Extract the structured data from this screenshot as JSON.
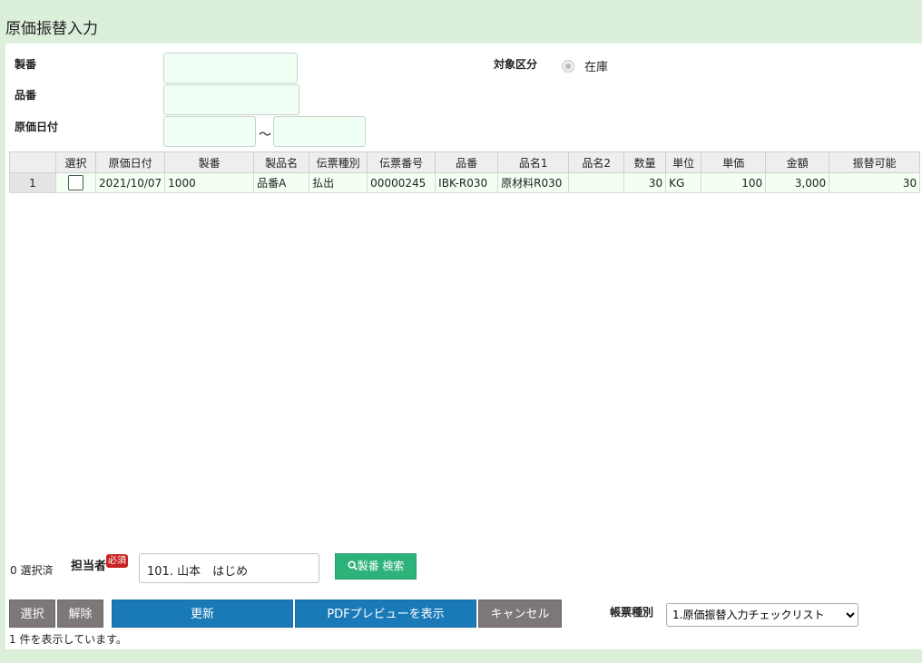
{
  "page": {
    "title": "原価振替入力"
  },
  "form": {
    "seiban_label": "製番",
    "hinban_label": "品番",
    "date_label": "原価日付",
    "range_sep": "～",
    "target_label": "対象区分",
    "target_option": "在庫"
  },
  "table": {
    "headers": [
      "",
      "選択",
      "原価日付",
      "製番",
      "製品名",
      "伝票種別",
      "伝票番号",
      "品番",
      "品名1",
      "品名2",
      "数量",
      "単位",
      "単価",
      "金額",
      "振替可能"
    ],
    "rows": [
      {
        "no": "1",
        "date": "2021/10/07",
        "seiban": "1000",
        "product": "品番A",
        "slip_type": "払出",
        "slip_no": "00000245",
        "hinban": "IBK-R030",
        "name1": "原材料R030",
        "name2": "",
        "qty": "30",
        "unit": "KG",
        "price": "100",
        "amount": "3,000",
        "transferable": "30"
      }
    ]
  },
  "footer": {
    "selected_count": "0 選択済",
    "tanto_label": "担当者",
    "required_badge": "必須",
    "tanto_value": "101. 山本　はじめ",
    "search_button": "製番 検索",
    "select_button": "選択",
    "clear_button": "解除",
    "update_button": "更新",
    "pdf_button": "PDFプレビューを表示",
    "cancel_button": "キャンセル",
    "report_label": "帳票種別",
    "report_selected": "1.原価振替入力チェックリスト",
    "status": "1 件を表示しています。"
  },
  "colors": {
    "accent_blue": "#1a7ab8",
    "accent_green": "#2db37a",
    "button_gray": "#7d7777",
    "background": "#dcefdb"
  },
  "icons": {
    "search": "search-icon",
    "dropdown": "chevron-down-icon"
  }
}
